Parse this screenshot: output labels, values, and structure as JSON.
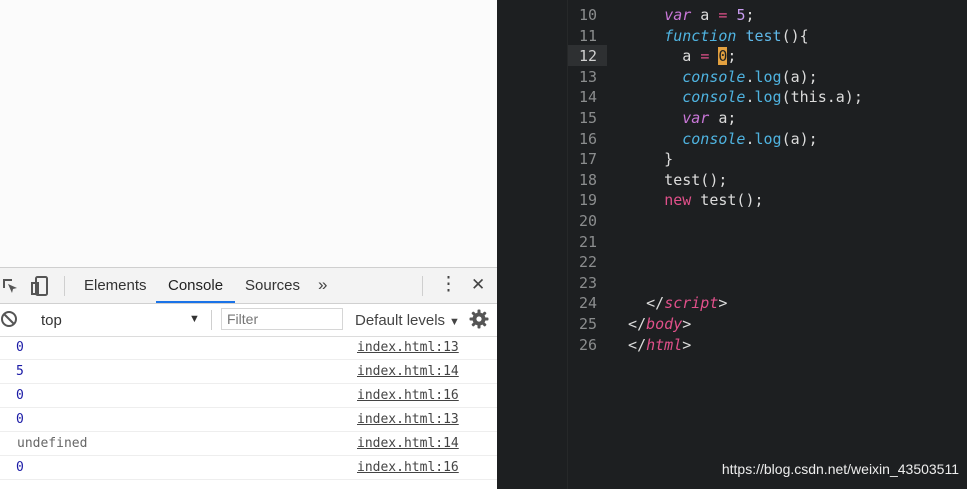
{
  "devtools": {
    "tabs": [
      {
        "label": "Elements",
        "active": false
      },
      {
        "label": "Console",
        "active": true
      },
      {
        "label": "Sources",
        "active": false
      }
    ],
    "more_tabs_glyph": "»",
    "menu_glyph": "⋮",
    "close_glyph": "✕",
    "context": "top",
    "filter_placeholder": "Filter",
    "levels_label": "Default levels",
    "console_rows": [
      {
        "value": "0",
        "kind": "number",
        "source": "index.html:13"
      },
      {
        "value": "5",
        "kind": "number",
        "source": "index.html:14"
      },
      {
        "value": "0",
        "kind": "number",
        "source": "index.html:16"
      },
      {
        "value": "0",
        "kind": "number",
        "source": "index.html:13"
      },
      {
        "value": "undefined",
        "kind": "undefined",
        "source": "index.html:14"
      },
      {
        "value": "0",
        "kind": "number",
        "source": "index.html:16"
      }
    ]
  },
  "editor": {
    "current_line": 12,
    "lines": [
      {
        "n": "10",
        "tokens": [
          {
            "t": "      "
          },
          {
            "t": "var",
            "c": "kw"
          },
          {
            "t": " a "
          },
          {
            "t": "=",
            "c": "op"
          },
          {
            "t": " "
          },
          {
            "t": "5",
            "c": "numlit"
          },
          {
            "t": ";"
          }
        ]
      },
      {
        "n": "11",
        "tokens": [
          {
            "t": "      "
          },
          {
            "t": "function",
            "c": "fn-kw"
          },
          {
            "t": " "
          },
          {
            "t": "test",
            "c": "fname"
          },
          {
            "t": "(){"
          }
        ]
      },
      {
        "n": "12",
        "tokens": [
          {
            "t": "        a "
          },
          {
            "t": "=",
            "c": "op"
          },
          {
            "t": " "
          },
          {
            "t": "0",
            "c": "cursor-hl"
          },
          {
            "t": ";"
          }
        ]
      },
      {
        "n": "13",
        "tokens": [
          {
            "t": "        "
          },
          {
            "t": "console",
            "c": "obj"
          },
          {
            "t": "."
          },
          {
            "t": "log",
            "c": "meth"
          },
          {
            "t": "(a);"
          }
        ]
      },
      {
        "n": "14",
        "tokens": [
          {
            "t": "        "
          },
          {
            "t": "console",
            "c": "obj"
          },
          {
            "t": "."
          },
          {
            "t": "log",
            "c": "meth"
          },
          {
            "t": "(this.a);"
          }
        ]
      },
      {
        "n": "15",
        "tokens": [
          {
            "t": "        "
          },
          {
            "t": "var",
            "c": "kw"
          },
          {
            "t": " a;"
          }
        ]
      },
      {
        "n": "16",
        "tokens": [
          {
            "t": "        "
          },
          {
            "t": "console",
            "c": "obj"
          },
          {
            "t": "."
          },
          {
            "t": "log",
            "c": "meth"
          },
          {
            "t": "(a);"
          }
        ]
      },
      {
        "n": "17",
        "tokens": [
          {
            "t": "      }"
          }
        ]
      },
      {
        "n": "18",
        "tokens": [
          {
            "t": "      test();"
          }
        ]
      },
      {
        "n": "19",
        "tokens": [
          {
            "t": "      "
          },
          {
            "t": "new",
            "c": "newkw"
          },
          {
            "t": " test();"
          }
        ]
      },
      {
        "n": "20",
        "tokens": []
      },
      {
        "n": "21",
        "tokens": []
      },
      {
        "n": "22",
        "tokens": []
      },
      {
        "n": "23",
        "tokens": []
      },
      {
        "n": "24",
        "tokens": [
          {
            "t": "    </"
          },
          {
            "t": "script",
            "c": "tag"
          },
          {
            "t": ">"
          }
        ]
      },
      {
        "n": "25",
        "tokens": [
          {
            "t": "  </"
          },
          {
            "t": "body",
            "c": "tag"
          },
          {
            "t": ">"
          }
        ]
      },
      {
        "n": "26",
        "tokens": [
          {
            "t": "  </"
          },
          {
            "t": "html",
            "c": "tag"
          },
          {
            "t": ">"
          }
        ]
      }
    ]
  },
  "watermark": "https://blog.csdn.net/weixin_43503511",
  "colors": {
    "editor_bg": "#1d1f21",
    "active_tab_underline": "#1a73e8",
    "cursor_highlight": "#e2a03f",
    "keyword": "#c977d8",
    "tag": "#e0508a"
  }
}
